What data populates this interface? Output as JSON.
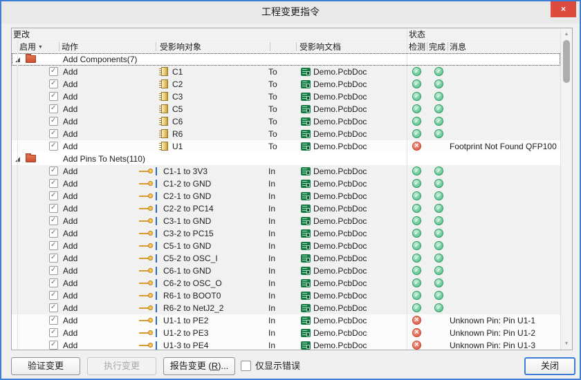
{
  "window": {
    "title": "工程变更指令",
    "close_glyph": "×"
  },
  "glyphs": {
    "expand": "◢",
    "filter": "▼",
    "scroll_up": "▲",
    "scroll_down": "▼"
  },
  "header": {
    "changes": "更改",
    "status": "状态",
    "enable": "启用",
    "action": "动作",
    "affected_object": "受影响对象",
    "affected_document": "受影响文档",
    "check": "检测",
    "done": "完成",
    "message": "消息"
  },
  "table": {
    "groups": [
      {
        "label": "Add Components(7)",
        "selected": true,
        "rows": [
          {
            "action": "Add",
            "icon": "component",
            "object": "C1",
            "prep": "To",
            "doc": "Demo.PcbDoc",
            "status": "ok",
            "message": ""
          },
          {
            "action": "Add",
            "icon": "component",
            "object": "C2",
            "prep": "To",
            "doc": "Demo.PcbDoc",
            "status": "ok",
            "message": ""
          },
          {
            "action": "Add",
            "icon": "component",
            "object": "C3",
            "prep": "To",
            "doc": "Demo.PcbDoc",
            "status": "ok",
            "message": ""
          },
          {
            "action": "Add",
            "icon": "component",
            "object": "C5",
            "prep": "To",
            "doc": "Demo.PcbDoc",
            "status": "ok",
            "message": ""
          },
          {
            "action": "Add",
            "icon": "component",
            "object": "C6",
            "prep": "To",
            "doc": "Demo.PcbDoc",
            "status": "ok",
            "message": ""
          },
          {
            "action": "Add",
            "icon": "component",
            "object": "R6",
            "prep": "To",
            "doc": "Demo.PcbDoc",
            "status": "ok",
            "message": ""
          },
          {
            "action": "Add",
            "icon": "component",
            "object": "U1",
            "prep": "To",
            "doc": "Demo.PcbDoc",
            "status": "error",
            "message": "Footprint Not Found QFP100"
          }
        ]
      },
      {
        "label": "Add Pins To Nets(110)",
        "selected": false,
        "rows": [
          {
            "action": "Add",
            "icon": "pin",
            "object": "C1-1 to 3V3",
            "prep": "In",
            "doc": "Demo.PcbDoc",
            "status": "ok",
            "message": ""
          },
          {
            "action": "Add",
            "icon": "pin",
            "object": "C1-2 to GND",
            "prep": "In",
            "doc": "Demo.PcbDoc",
            "status": "ok",
            "message": ""
          },
          {
            "action": "Add",
            "icon": "pin",
            "object": "C2-1 to GND",
            "prep": "In",
            "doc": "Demo.PcbDoc",
            "status": "ok",
            "message": ""
          },
          {
            "action": "Add",
            "icon": "pin",
            "object": "C2-2 to PC14",
            "prep": "In",
            "doc": "Demo.PcbDoc",
            "status": "ok",
            "message": ""
          },
          {
            "action": "Add",
            "icon": "pin",
            "object": "C3-1 to GND",
            "prep": "In",
            "doc": "Demo.PcbDoc",
            "status": "ok",
            "message": ""
          },
          {
            "action": "Add",
            "icon": "pin",
            "object": "C3-2 to PC15",
            "prep": "In",
            "doc": "Demo.PcbDoc",
            "status": "ok",
            "message": ""
          },
          {
            "action": "Add",
            "icon": "pin",
            "object": "C5-1 to GND",
            "prep": "In",
            "doc": "Demo.PcbDoc",
            "status": "ok",
            "message": ""
          },
          {
            "action": "Add",
            "icon": "pin",
            "object": "C5-2 to OSC_I",
            "prep": "In",
            "doc": "Demo.PcbDoc",
            "status": "ok",
            "message": ""
          },
          {
            "action": "Add",
            "icon": "pin",
            "object": "C6-1 to GND",
            "prep": "In",
            "doc": "Demo.PcbDoc",
            "status": "ok",
            "message": ""
          },
          {
            "action": "Add",
            "icon": "pin",
            "object": "C6-2 to OSC_O",
            "prep": "In",
            "doc": "Demo.PcbDoc",
            "status": "ok",
            "message": ""
          },
          {
            "action": "Add",
            "icon": "pin",
            "object": "R6-1 to BOOT0",
            "prep": "In",
            "doc": "Demo.PcbDoc",
            "status": "ok",
            "message": ""
          },
          {
            "action": "Add",
            "icon": "pin",
            "object": "R6-2 to NetJ2_2",
            "prep": "In",
            "doc": "Demo.PcbDoc",
            "status": "ok",
            "message": ""
          },
          {
            "action": "Add",
            "icon": "pin",
            "object": "U1-1 to PE2",
            "prep": "In",
            "doc": "Demo.PcbDoc",
            "status": "error",
            "message": "Unknown Pin: Pin U1-1"
          },
          {
            "action": "Add",
            "icon": "pin",
            "object": "U1-2 to PE3",
            "prep": "In",
            "doc": "Demo.PcbDoc",
            "status": "error",
            "message": "Unknown Pin: Pin U1-2"
          },
          {
            "action": "Add",
            "icon": "pin",
            "object": "U1-3 to PE4",
            "prep": "In",
            "doc": "Demo.PcbDoc",
            "status": "error",
            "message": "Unknown Pin: Pin U1-3"
          }
        ]
      }
    ]
  },
  "footer": {
    "validate": "验证变更",
    "execute": "执行变更",
    "report_prefix": "报告变更 (",
    "report_key": "R",
    "report_suffix": ")...",
    "only_errors": "仅显示错误",
    "close": "关闭"
  }
}
